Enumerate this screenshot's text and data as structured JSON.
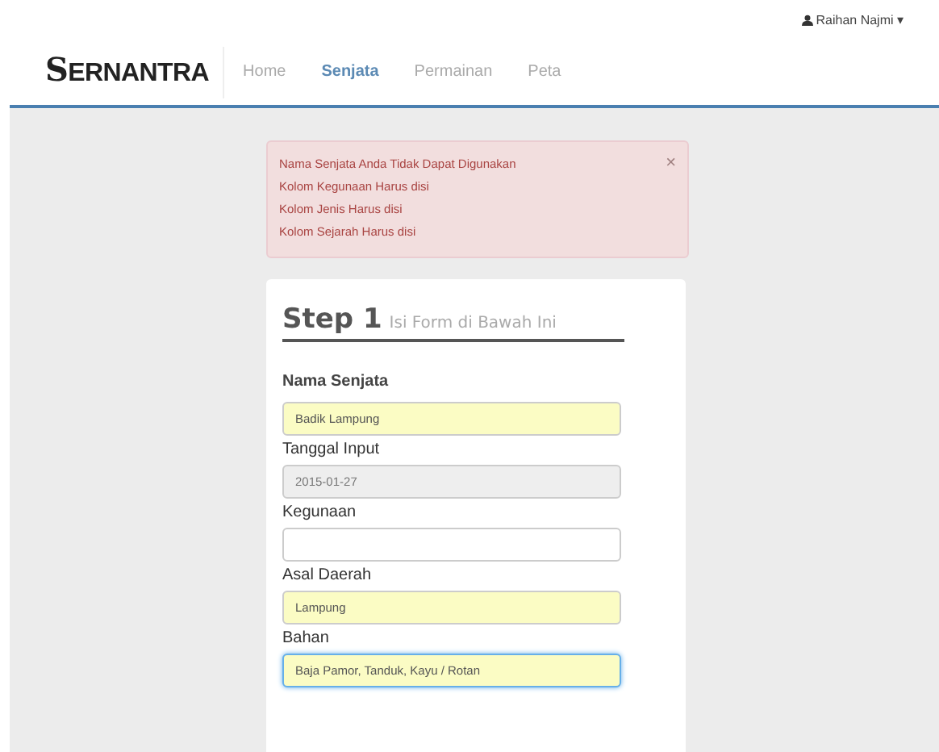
{
  "user_menu": {
    "name": "Raihan Najmi",
    "caret": "▾"
  },
  "brand": {
    "initial": "S",
    "rest": "ERNANTRA"
  },
  "nav": [
    {
      "label": "Home",
      "selected": false
    },
    {
      "label": "Senjata",
      "selected": true
    },
    {
      "label": "Permainan",
      "selected": false
    },
    {
      "label": "Peta",
      "selected": false
    }
  ],
  "alert": {
    "close": "×",
    "messages": [
      "Nama Senjata Anda Tidak Dapat Digunakan",
      "Kolom Kegunaan Harus disi",
      "Kolom Jenis Harus disi",
      "Kolom Sejarah Harus disi"
    ]
  },
  "form": {
    "step": "Step 1",
    "subtitle": "Isi Form di Bawah Ini",
    "fields": [
      {
        "label": "Nama Senjata",
        "value": "Badik Lampung",
        "autofilled": true,
        "disabled": false,
        "focused": false
      },
      {
        "label": "Tanggal Input",
        "value": "2015-01-27",
        "autofilled": false,
        "disabled": true,
        "focused": false
      },
      {
        "label": "Kegunaan",
        "autofilled": false,
        "disabled": false,
        "focused": false
      },
      {
        "label": "Asal Daerah",
        "value": "Lampung",
        "autofilled": true,
        "disabled": false,
        "focused": false
      },
      {
        "label": "Bahan",
        "value": "Baja Pamor, Tanduk, Kayu / Rotan",
        "autofilled": true,
        "disabled": false,
        "focused": true
      }
    ]
  }
}
